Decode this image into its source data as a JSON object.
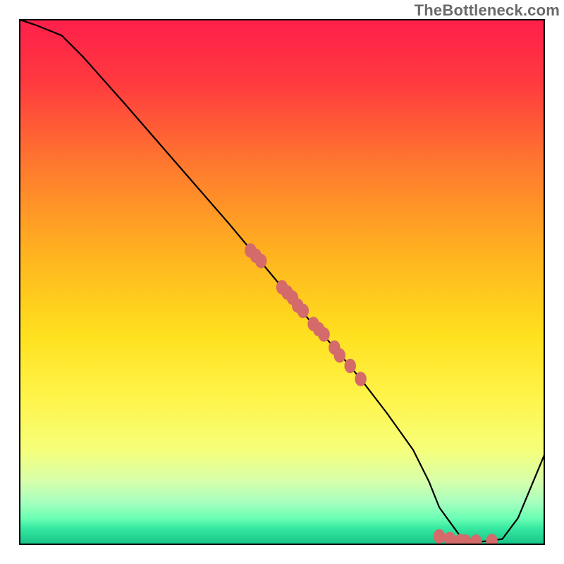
{
  "watermark": "TheBottleneck.com",
  "colors": {
    "curve": "#000000",
    "dot": "#d46a6a",
    "gradient_top": "#ff1f4b",
    "gradient_bottom": "#17c487"
  },
  "chart_data": {
    "type": "line",
    "title": "",
    "xlabel": "",
    "ylabel": "",
    "xlim": [
      0,
      100
    ],
    "ylim": [
      0,
      100
    ],
    "x": [
      0,
      3,
      8,
      12,
      20,
      30,
      40,
      50,
      55,
      60,
      65,
      70,
      75,
      78,
      80,
      84,
      88,
      92,
      95,
      100
    ],
    "y": [
      100,
      99,
      97,
      93,
      84,
      72.5,
      61,
      49,
      43,
      37.5,
      31.5,
      25,
      18,
      12,
      7,
      1.5,
      0.5,
      1,
      5,
      17
    ],
    "dots_x": [
      44,
      45,
      46,
      50,
      51,
      52,
      53,
      54,
      56,
      57,
      58,
      60,
      61,
      63,
      65,
      80,
      82,
      84,
      85,
      87,
      90
    ],
    "dots_y": [
      56,
      55,
      54,
      49,
      48,
      47,
      45.5,
      44.5,
      42,
      41,
      40,
      37.5,
      36,
      34,
      31.5,
      1.5,
      1,
      0.6,
      0.5,
      0.5,
      0.6
    ]
  }
}
